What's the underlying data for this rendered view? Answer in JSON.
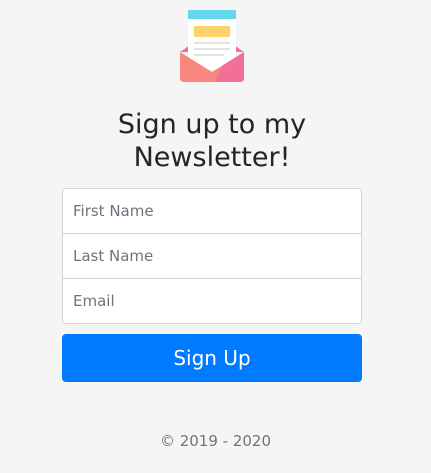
{
  "logo": {
    "icon": "open-envelope-letter-icon"
  },
  "heading": {
    "title": "Sign up to my Newsletter!"
  },
  "form": {
    "first_name_placeholder": "First Name",
    "last_name_placeholder": "Last Name",
    "email_placeholder": "Email",
    "submit_label": "Sign Up"
  },
  "footer": {
    "copyright": "© 2019 - 2020"
  },
  "colors": {
    "background": "#f5f5f5",
    "primary": "#007bff",
    "envelope": "#f8877f"
  }
}
